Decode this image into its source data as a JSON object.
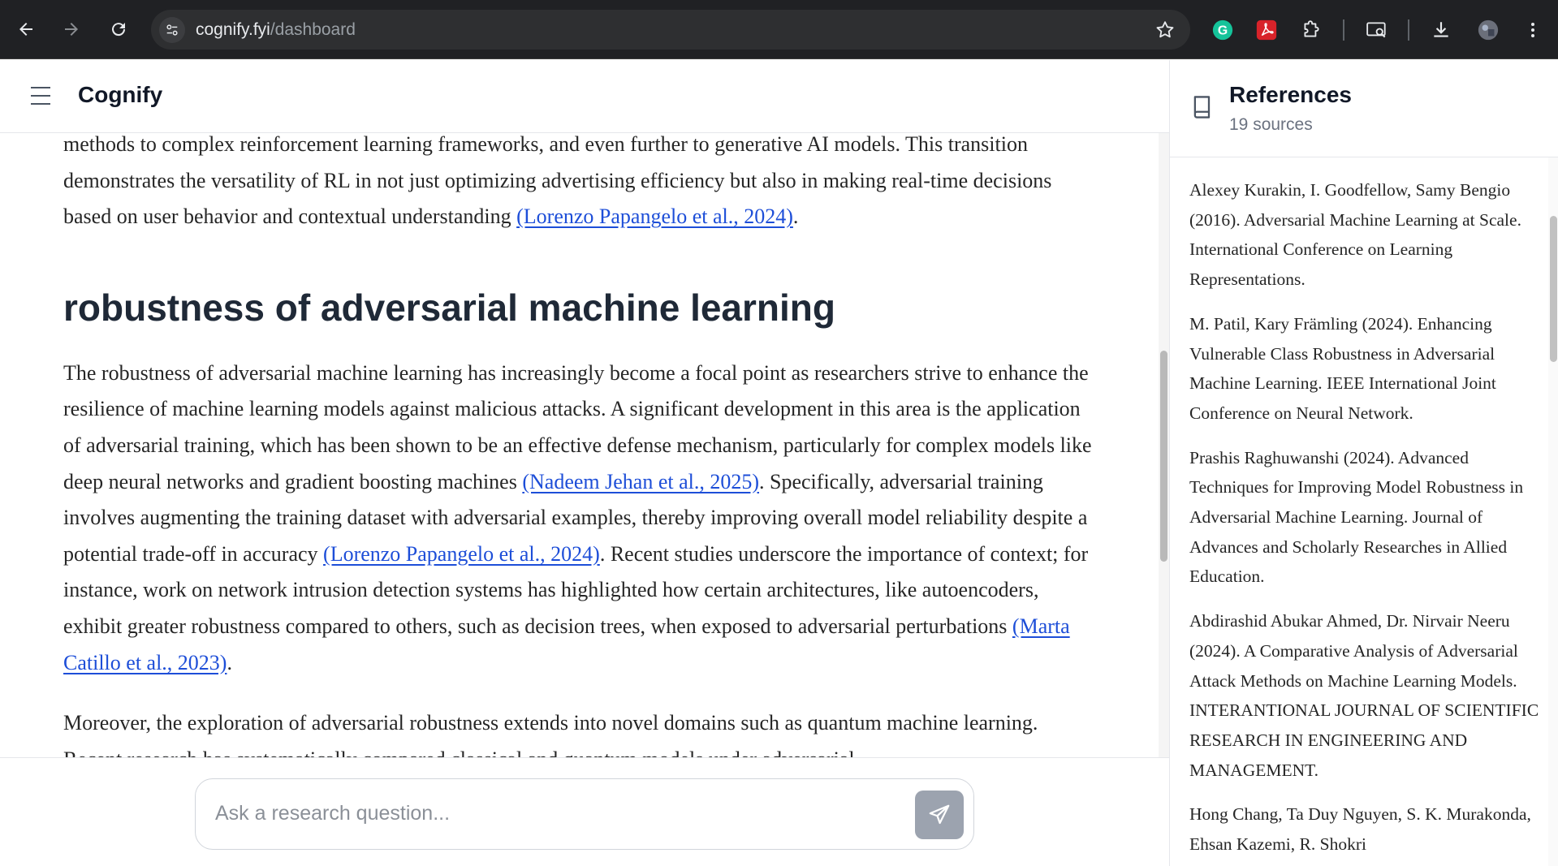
{
  "browser": {
    "url_host": "cognify.fyi",
    "url_path": "/dashboard"
  },
  "app": {
    "brand": "Cognify"
  },
  "article": {
    "intro": {
      "text": "methods to complex reinforcement learning frameworks, and even further to generative AI models. This transition demonstrates the versatility of RL in not just optimizing advertising efficiency but also in making real-time decisions based on user behavior and contextual understanding ",
      "cite1": "(Lorenzo Papangelo et al., 2024)",
      "end": "."
    },
    "section_title": "robustness of adversarial machine learning",
    "p1": {
      "t1": "The robustness of adversarial machine learning has increasingly become a focal point as researchers strive to enhance the resilience of machine learning models against malicious attacks. A significant development in this area is the application of adversarial training, which has been shown to be an effective defense mechanism, particularly for complex models like deep neural networks and gradient boosting machines ",
      "c1": "(Nadeem Jehan et al., 2025)",
      "t2": ". Specifically, adversarial training involves augmenting the training dataset with adversarial examples, thereby improving overall model reliability despite a potential trade-off in accuracy ",
      "c2": "(Lorenzo Papangelo et al., 2024)",
      "t3": ". Recent studies underscore the importance of context; for instance, work on network intrusion detection systems has highlighted how certain architectures, like autoencoders, exhibit greater robustness compared to others, such as decision trees, when exposed to adversarial perturbations ",
      "c3": "(Marta Catillo et al., 2023)",
      "t4": "."
    },
    "p2": {
      "t1": "Moreover, the exploration of adversarial robustness extends into novel domains such as quantum machine learning. Recent research has systematically compared classical and quantum models under adversarial"
    }
  },
  "composer": {
    "placeholder": "Ask a research question..."
  },
  "references": {
    "title": "References",
    "count": "19 sources",
    "items": [
      "Alexey Kurakin, I. Goodfellow, Samy Bengio (2016). Adversarial Machine Learning at Scale. International Conference on Learning Representations.",
      "M. Patil, Kary Främling (2024). Enhancing Vulnerable Class Robustness in Adversarial Machine Learning. IEEE International Joint Conference on Neural Network.",
      "Prashis Raghuwanshi (2024). Advanced Techniques for Improving Model Robustness in Adversarial Machine Learning. Journal of Advances and Scholarly Researches in Allied Education.",
      "Abdirashid Abukar Ahmed, Dr. Nirvair Neeru (2024). A Comparative Analysis of Adversarial Attack Methods on Machine Learning Models. INTERANTIONAL JOURNAL OF SCIENTIFIC RESEARCH IN ENGINEERING AND MANAGEMENT.",
      "Hong Chang, Ta Duy Nguyen, S. K. Murakonda, Ehsan Kazemi, R. Shokri"
    ]
  }
}
